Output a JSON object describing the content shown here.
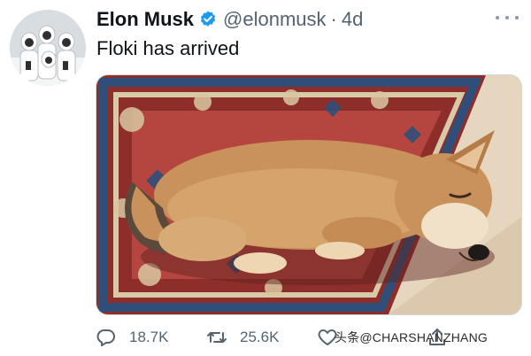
{
  "tweet": {
    "author": {
      "display_name": "Elon Musk",
      "verified": true,
      "handle": "@elonmusk",
      "separator": "·",
      "time": "4d"
    },
    "text": "Floki has arrived",
    "media": {
      "description_icon": "photo-icon"
    },
    "actions": {
      "reply_count": "18.7K",
      "retweet_count": "25.6K"
    },
    "watermark": "头条@CHARSHANZHANG"
  },
  "colors": {
    "verified_badge": "#1d9bf0",
    "secondary_text": "#536471",
    "primary_text": "#0f1419"
  }
}
